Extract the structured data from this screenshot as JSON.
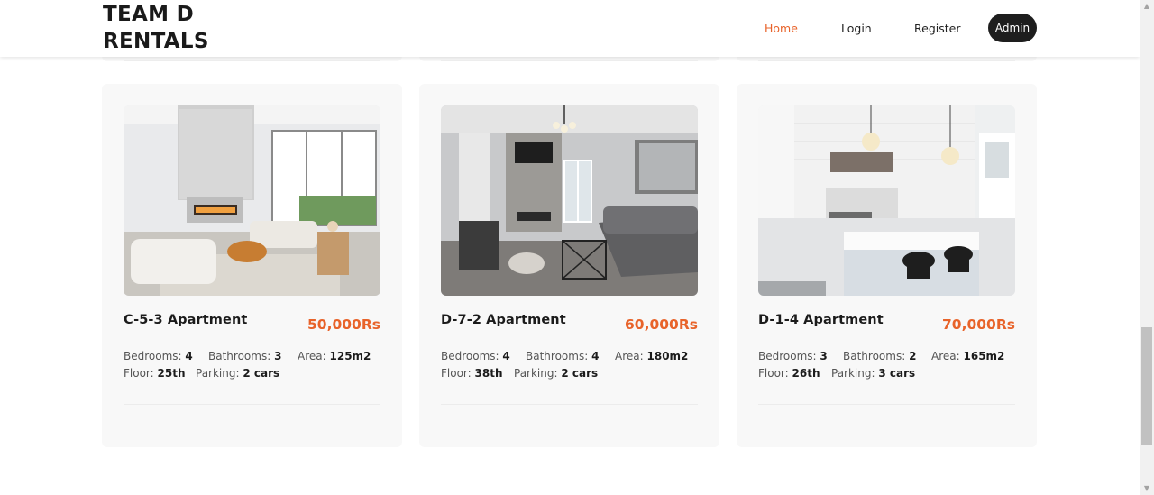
{
  "brand": {
    "line1": "TEAM D",
    "line2": "RENTALS"
  },
  "nav": {
    "home": "Home",
    "login": "Login",
    "register": "Register",
    "admin": "Admin"
  },
  "colors": {
    "accent": "#e8632a",
    "dark": "#1e1e1e",
    "card_bg": "#f8f8f8"
  },
  "labels": {
    "bedrooms": "Bedrooms:",
    "bathrooms": "Bathrooms:",
    "area": "Area:",
    "floor": "Floor:",
    "parking": "Parking:"
  },
  "listings": [
    {
      "title": "C-5-3 Apartment",
      "price": "50,000Rs",
      "bedrooms": "4",
      "bathrooms": "3",
      "area": "125m2",
      "floor": "25th",
      "parking": "2 cars",
      "photo": "living-room-photo"
    },
    {
      "title": "D-7-2 Apartment",
      "price": "60,000Rs",
      "bedrooms": "4",
      "bathrooms": "4",
      "area": "180m2",
      "floor": "38th",
      "parking": "2 cars",
      "photo": "lounge-photo"
    },
    {
      "title": "D-1-4 Apartment",
      "price": "70,000Rs",
      "bedrooms": "3",
      "bathrooms": "2",
      "area": "165m2",
      "floor": "26th",
      "parking": "3 cars",
      "photo": "kitchen-photo"
    }
  ]
}
